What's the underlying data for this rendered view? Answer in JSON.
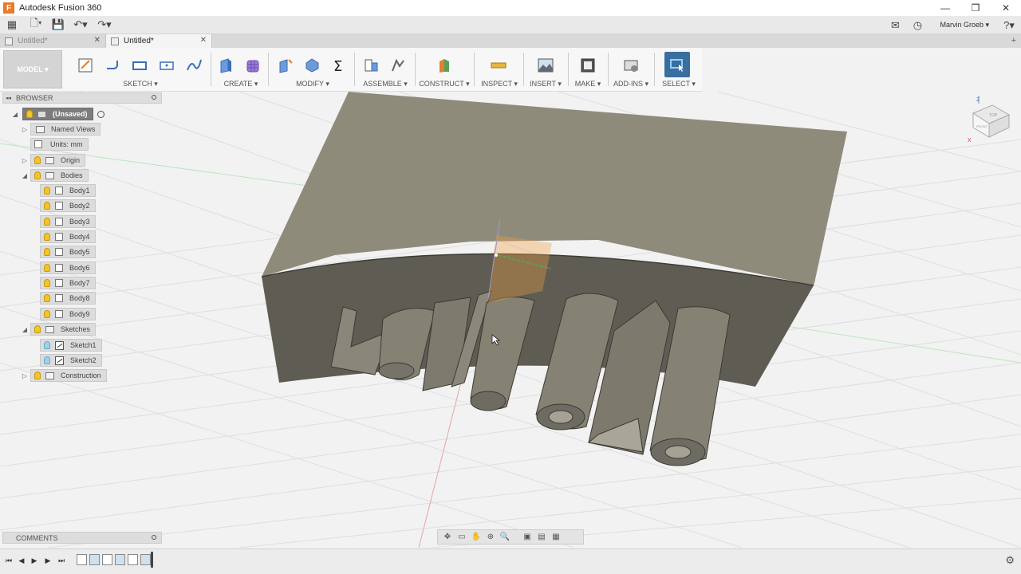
{
  "app": {
    "title": "Autodesk Fusion 360",
    "logo_letter": "F"
  },
  "window": {
    "minimize": "—",
    "maximize": "❐",
    "close": "✕"
  },
  "qat": {
    "grid": "▦",
    "file": "🗋▾",
    "save": "💾",
    "undo": "↶▾",
    "redo": "↷▾",
    "job_status": "✉",
    "recent": "◷",
    "user_name": "Marvin Groeb ▾",
    "help": "?▾"
  },
  "tabs": [
    {
      "label": "Untitled*",
      "close": "✕"
    },
    {
      "label": "Untitled*",
      "close": "✕"
    }
  ],
  "tabs_new": "+",
  "toolbar": {
    "workspace": "MODEL ▾",
    "groups": [
      {
        "label": "SKETCH ▾"
      },
      {
        "label": "CREATE ▾"
      },
      {
        "label": "MODIFY ▾"
      },
      {
        "label": "ASSEMBLE ▾"
      },
      {
        "label": "CONSTRUCT ▾"
      },
      {
        "label": "INSPECT ▾"
      },
      {
        "label": "INSERT ▾"
      },
      {
        "label": "MAKE ▾"
      },
      {
        "label": "ADD-INS ▾"
      },
      {
        "label": "SELECT ▾"
      }
    ],
    "accent": "#3a6e9e"
  },
  "browser": {
    "title": "BROWSER",
    "collapse": "◂◂",
    "root": "(Unsaved)",
    "named_views": "Named Views",
    "units": "Units: mm",
    "origin": "Origin",
    "bodies": "Bodies",
    "body_items": [
      "Body1",
      "Body2",
      "Body3",
      "Body4",
      "Body5",
      "Body6",
      "Body7",
      "Body8",
      "Body9"
    ],
    "sketches": "Sketches",
    "sketch_items": [
      "Sketch1",
      "Sketch2"
    ],
    "construction": "Construction"
  },
  "comments": {
    "title": "COMMENTS"
  },
  "viewcube": {
    "top": "TOP",
    "front": "FRONT",
    "axis_z": "Z",
    "axis_x": "X"
  },
  "colors": {
    "body_fill": "#8c8878",
    "body_dark": "#5e5c52",
    "grid": "#dcdcdc"
  }
}
